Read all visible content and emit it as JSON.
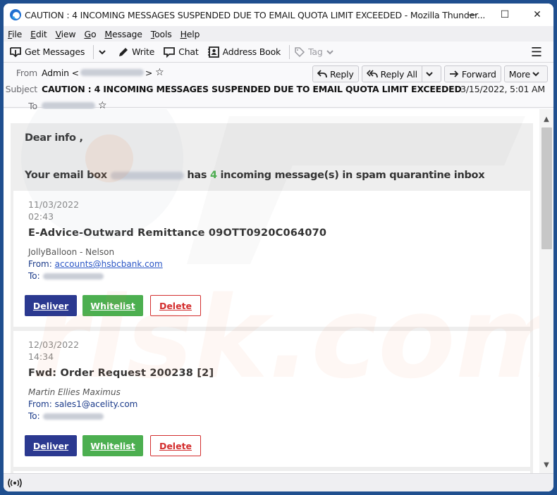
{
  "window": {
    "title": "CAUTION : 4 INCOMING MESSAGES SUSPENDED DUE TO EMAIL QUOTA LIMIT EXCEEDED - Mozilla Thunder...",
    "controls": {
      "minimize": "—",
      "maximize": "☐",
      "close": "✕"
    }
  },
  "menubar": [
    {
      "accel": "F",
      "rest": "ile"
    },
    {
      "accel": "E",
      "rest": "dit"
    },
    {
      "accel": "V",
      "rest": "iew"
    },
    {
      "accel": "G",
      "rest": "o"
    },
    {
      "accel": "M",
      "rest": "essage"
    },
    {
      "accel": "T",
      "rest": "ools"
    },
    {
      "accel": "H",
      "rest": "elp"
    }
  ],
  "toolbar": {
    "get_messages": "Get Messages",
    "write": "Write",
    "chat": "Chat",
    "address_book": "Address Book",
    "tag": "Tag",
    "menu_icon": "☰"
  },
  "header": {
    "from_label": "From",
    "from_name": "Admin <",
    "from_close": ">",
    "subject_label": "Subject",
    "subject": "CAUTION : 4 INCOMING MESSAGES SUSPENDED DUE TO EMAIL QUOTA LIMIT EXCEEDED",
    "to_label": "To",
    "date": "3/15/2022, 5:01 AM",
    "buttons": {
      "reply": "Reply",
      "reply_all": "Reply All",
      "forward": "Forward",
      "more": "More"
    }
  },
  "message": {
    "greeting": "Dear  info ,",
    "intro_prefix": "Your email box",
    "intro_mid": "has",
    "count": "4",
    "intro_suffix": "incoming message(s) in spam quarantine inbox",
    "count_color": "#4caf50",
    "quarantined": [
      {
        "date": "11/03/2022",
        "time": "02:43",
        "subject": "E-Advice-Outward Remittance 09OTT0920C064070",
        "sender": "JollyBalloon - Nelson",
        "from_label": "From:",
        "from_email": "accounts@hsbcbank.com",
        "to_label": "To:"
      },
      {
        "date": "12/03/2022",
        "time": "14:34",
        "subject": "Fwd: Order Request 200238 [2]",
        "sender": "Martin Ellies Maximus",
        "from_label": "From:",
        "from_email": "sales1@acelity.com",
        "to_label": "To:"
      }
    ],
    "actions": {
      "deliver": "Deliver",
      "whitelist": "Whitelist",
      "delete": "Delete"
    },
    "colors": {
      "deliver": "#2b3990",
      "whitelist": "#4caf50",
      "delete": "#d32f2f"
    }
  }
}
